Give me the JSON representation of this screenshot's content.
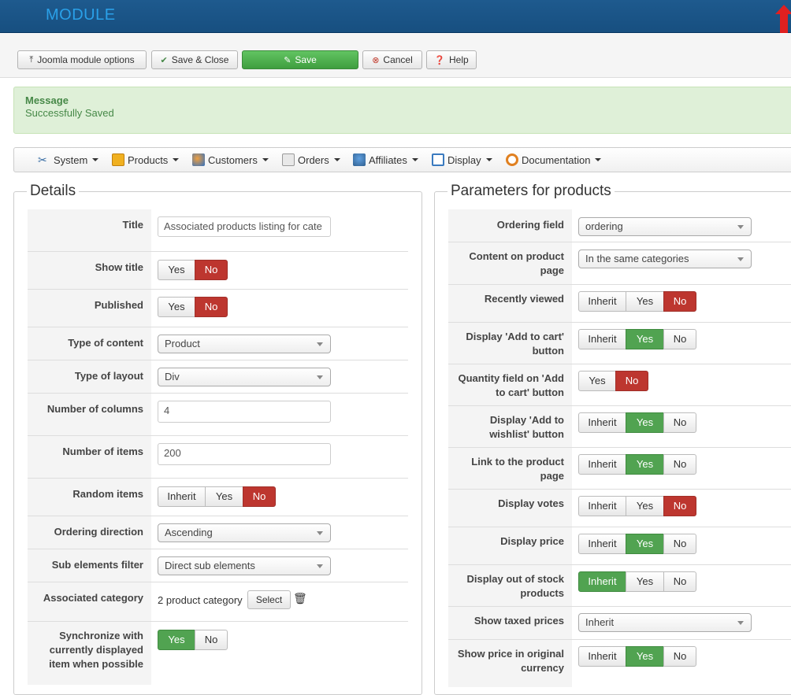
{
  "header": {
    "title": "MODULE"
  },
  "toolbar": {
    "buttons": [
      {
        "label": "Joomla module options",
        "icon": "upload-icon"
      },
      {
        "label": "Save & Close",
        "icon": "check-icon"
      },
      {
        "label": "Save",
        "icon": "edit-icon"
      },
      {
        "label": "Cancel",
        "icon": "cancel-icon"
      },
      {
        "label": "Help",
        "icon": "help-icon"
      }
    ]
  },
  "message": {
    "heading": "Message",
    "text": "Successfully Saved"
  },
  "menu": {
    "items": [
      {
        "label": "System",
        "icon": "tools-icon"
      },
      {
        "label": "Products",
        "icon": "products-icon"
      },
      {
        "label": "Customers",
        "icon": "customers-icon"
      },
      {
        "label": "Orders",
        "icon": "orders-icon"
      },
      {
        "label": "Affiliates",
        "icon": "affiliates-icon"
      },
      {
        "label": "Display",
        "icon": "display-icon"
      },
      {
        "label": "Documentation",
        "icon": "help-ring-icon"
      }
    ]
  },
  "details": {
    "legend": "Details",
    "title_label": "Title",
    "title_value": "Associated products listing for cate",
    "show_title_label": "Show title",
    "published_label": "Published",
    "type_content_label": "Type of content",
    "type_content_value": "Product",
    "type_layout_label": "Type of layout",
    "type_layout_value": "Div",
    "columns_label": "Number of columns",
    "columns_value": "4",
    "items_label": "Number of items",
    "items_value": "200",
    "random_label": "Random items",
    "order_dir_label": "Ordering direction",
    "order_dir_value": "Ascending",
    "sub_filter_label": "Sub elements filter",
    "sub_filter_value": "Direct sub elements",
    "assoc_cat_label": "Associated category",
    "assoc_cat_value": "2 product category",
    "select_label": "Select",
    "sync_label": "Synchronize with currently displayed item when possible",
    "yes": "Yes",
    "no": "No",
    "inherit": "Inherit"
  },
  "params": {
    "legend": "Parameters for products",
    "ordering_field_label": "Ordering field",
    "ordering_field_value": "ordering",
    "content_page_label": "Content on product page",
    "content_page_value": "In the same categories",
    "recently_viewed_label": "Recently viewed",
    "add_cart_label": "Display 'Add to cart' button",
    "qty_field_label": "Quantity field on 'Add to cart' button",
    "wishlist_label": "Display 'Add to wishlist' button",
    "link_product_label": "Link to the product page",
    "votes_label": "Display votes",
    "price_label": "Display price",
    "out_stock_label": "Display out of stock products",
    "taxed_label": "Show taxed prices",
    "taxed_value": "Inherit",
    "orig_currency_label": "Show price in original currency",
    "yes": "Yes",
    "no": "No",
    "inherit": "Inherit"
  },
  "colors": {
    "accent_red": "#bd362f",
    "accent_green": "#51a351",
    "header_blue": "#1e5a8e"
  }
}
